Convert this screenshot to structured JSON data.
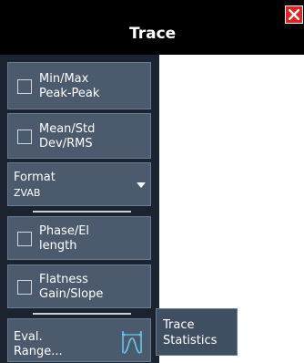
{
  "window": {
    "title": "Trace",
    "close_icon": "close-icon"
  },
  "colors": {
    "header_bg": "#000000",
    "panel_bg": "#1b2330",
    "button_bg": "#4b5a6c",
    "close_bg": "#e52222"
  },
  "buttons": {
    "min_max": {
      "line1": "Min/Max",
      "line2": "Peak-Peak",
      "checked": false
    },
    "mean_std": {
      "line1": "Mean/Std",
      "line2": "Dev/RMS",
      "checked": false
    },
    "format": {
      "label": "Format",
      "value": "ZVAB",
      "icon": "chevron-down-icon"
    },
    "phase": {
      "line1": "Phase/El",
      "line2": "length",
      "checked": false
    },
    "flatness": {
      "line1": "Flatness",
      "line2": "Gain/Slope",
      "checked": false
    },
    "eval_range": {
      "line1": "Eval.",
      "line2": "Range...",
      "icon": "eval-range-icon"
    }
  },
  "tooltip": {
    "line1": "Trace",
    "line2": "Statistics"
  }
}
